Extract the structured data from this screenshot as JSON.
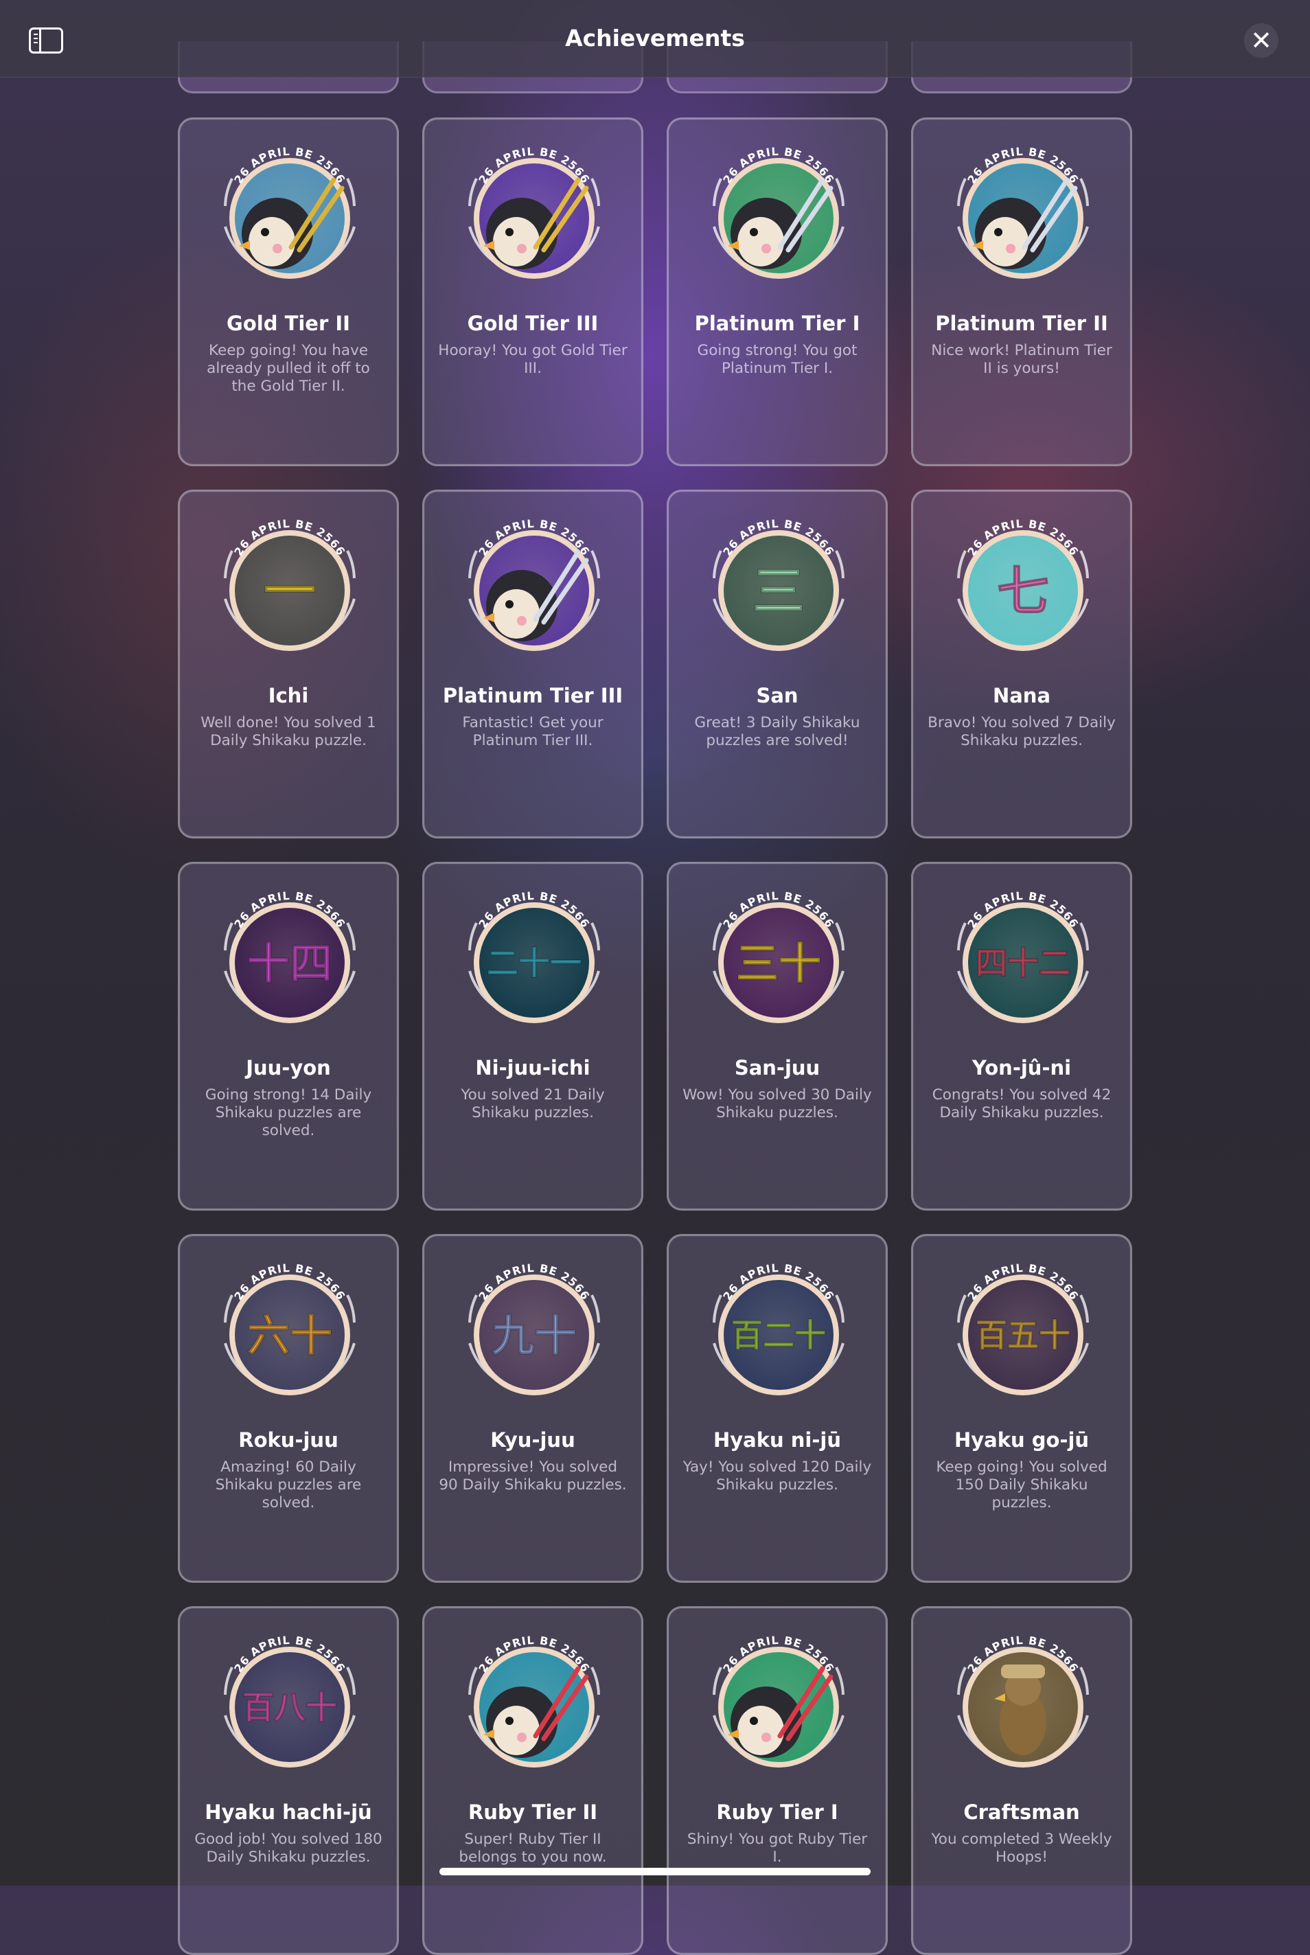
{
  "header": {
    "title": "Achievements",
    "sidebar_icon": "sidebar-toggle-icon",
    "close_icon": "close-icon",
    "close_glyph": "✕"
  },
  "badge_date_text": "26 APRIL BE 2566",
  "achievements": [
    {
      "title": "Gold Tier II",
      "description": "Keep going! You have already pulled it off to the Gold Tier II.",
      "icon": "penguin-gold-chopsticks-icon",
      "colors": [
        "#4e8fb5",
        "#d9b23a"
      ]
    },
    {
      "title": "Gold Tier III",
      "description": "Hooray! You got Gold Tier III.",
      "icon": "penguin-gold-chopsticks-icon",
      "colors": [
        "#5a3aa0",
        "#e0b840"
      ]
    },
    {
      "title": "Platinum Tier I",
      "description": "Going strong! You got Platinum Tier I.",
      "icon": "penguin-platinum-chopsticks-icon",
      "colors": [
        "#3a9a6a",
        "#d6dce8"
      ]
    },
    {
      "title": "Platinum Tier II",
      "description": "Nice work! Platinum Tier II is yours!",
      "icon": "penguin-platinum-chopsticks-icon",
      "colors": [
        "#3a8fb0",
        "#d6dce8"
      ]
    },
    {
      "title": "Ichi",
      "description": "Well done! You solved 1 Daily Shikaku puzzle.",
      "icon": "kanji-one-icon",
      "glyph": "一",
      "colors": [
        "#4a4a4a",
        "#e6c632"
      ]
    },
    {
      "title": "Platinum Tier III",
      "description": "Fantastic! Get your Platinum Tier III.",
      "icon": "penguin-platinum-chopsticks-icon",
      "colors": [
        "#5a3a9a",
        "#d6dce8"
      ]
    },
    {
      "title": "San",
      "description": "Great! 3 Daily Shikaku puzzles are solved!",
      "icon": "kanji-three-icon",
      "glyph": "三",
      "colors": [
        "#3f5a4e",
        "#9de0b4"
      ]
    },
    {
      "title": "Nana",
      "description": "Bravo! You solved 7 Daily Shikaku puzzles.",
      "icon": "kanji-seven-icon",
      "glyph": "七",
      "colors": [
        "#5fc3c6",
        "#d96fb2"
      ]
    },
    {
      "title": "Juu-yon",
      "description": "Going strong! 14 Daily Shikaku puzzles are solved.",
      "icon": "kanji-fourteen-icon",
      "glyph": "十四",
      "colors": [
        "#3b1f4e",
        "#c84fc8"
      ]
    },
    {
      "title": "Ni-juu-ichi",
      "description": "You solved 21 Daily Shikaku puzzles.",
      "icon": "kanji-twenty-one-icon",
      "glyph": "二十一",
      "colors": [
        "#123a4a",
        "#38b6cc"
      ]
    },
    {
      "title": "San-juu",
      "description": "Wow! You solved 30 Daily Shikaku puzzles.",
      "icon": "kanji-thirty-icon",
      "glyph": "三十",
      "colors": [
        "#4a2458",
        "#e6c632"
      ]
    },
    {
      "title": "Yon-jû-ni",
      "description": "Congrats! You solved 42 Daily Shikaku puzzles.",
      "icon": "kanji-forty-two-icon",
      "glyph": "四十二",
      "colors": [
        "#1d4a4e",
        "#e0506e"
      ]
    },
    {
      "title": "Roku-juu",
      "description": "Amazing! 60 Daily Shikaku puzzles are solved.",
      "icon": "kanji-sixty-icon",
      "glyph": "六十",
      "colors": [
        "#40405e",
        "#e6a23c"
      ]
    },
    {
      "title": "Kyu-juu",
      "description": "Impressive! You solved 90 Daily Shikaku puzzles.",
      "icon": "kanji-ninety-icon",
      "glyph": "九十",
      "colors": [
        "#4e3c5a",
        "#8fa0d6"
      ]
    },
    {
      "title": "Hyaku ni-jū",
      "description": "Yay! You solved 120 Daily Shikaku puzzles.",
      "icon": "kanji-one-twenty-icon",
      "glyph": "百二十",
      "colors": [
        "#2f3a5e",
        "#a6d64a"
      ]
    },
    {
      "title": "Hyaku go-jū",
      "description": "Keep going! You solved 150 Daily Shikaku puzzles.",
      "icon": "kanji-one-fifty-icon",
      "glyph": "百五十",
      "colors": [
        "#3f2f4a",
        "#e6b640"
      ]
    },
    {
      "title": "Hyaku hachi-jū",
      "description": "Good job! You solved 180 Daily Shikaku puzzles.",
      "icon": "kanji-one-eighty-icon",
      "glyph": "百八十",
      "colors": [
        "#3a3a5e",
        "#e05ab6"
      ]
    },
    {
      "title": "Ruby Tier II",
      "description": "Super! Ruby Tier II belongs to you now.",
      "icon": "penguin-ruby-chopsticks-icon",
      "colors": [
        "#2a8fa8",
        "#d83a4a"
      ]
    },
    {
      "title": "Ruby Tier I",
      "description": "Shiny! You got Ruby Tier I.",
      "icon": "penguin-ruby-chopsticks-icon",
      "colors": [
        "#2e9a6a",
        "#d83a4a"
      ]
    },
    {
      "title": "Craftsman",
      "description": "You completed 3 Weekly Hoops!",
      "icon": "craftsman-bird-icon",
      "colors": [
        "#6a5a3a",
        "#c9b07a"
      ]
    }
  ]
}
